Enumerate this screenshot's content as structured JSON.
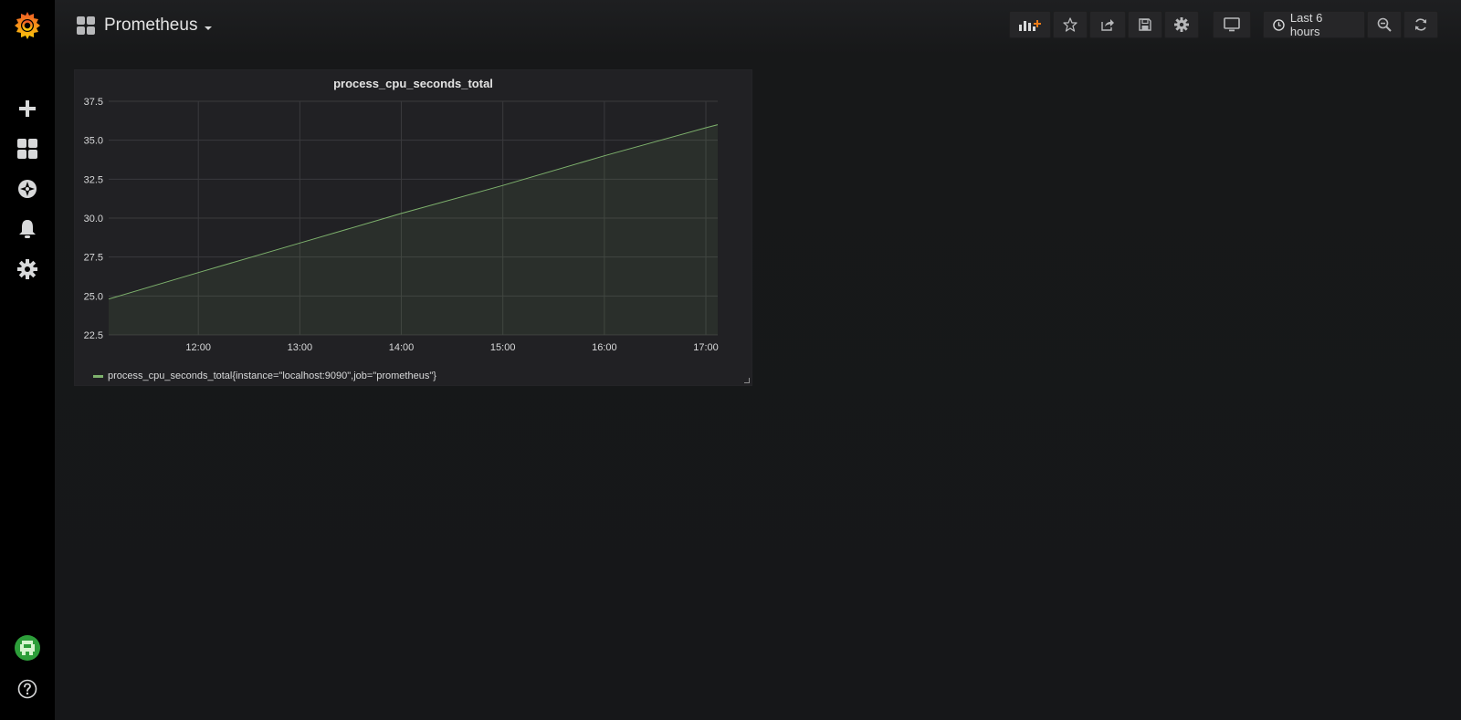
{
  "sidebar": {
    "items": [
      {
        "name": "create",
        "icon": "plus-icon"
      },
      {
        "name": "dashboards",
        "icon": "dashboards-icon"
      },
      {
        "name": "explore",
        "icon": "compass-icon"
      },
      {
        "name": "alerting",
        "icon": "bell-icon"
      },
      {
        "name": "configuration",
        "icon": "gear-icon"
      }
    ],
    "profile_icon": "avatar",
    "help_icon": "help-icon"
  },
  "header": {
    "dashboard_title": "Prometheus",
    "time_range": "Last 6 hours",
    "buttons": [
      "add-panel-icon",
      "star-icon",
      "share-icon",
      "save-icon",
      "settings-icon",
      "tv-icon",
      "zoom-out-icon",
      "refresh-icon"
    ]
  },
  "panel": {
    "title": "process_cpu_seconds_total",
    "legend": "process_cpu_seconds_total{instance=\"localhost:9090\",job=\"prometheus\"}"
  },
  "chart_data": {
    "type": "area",
    "title": "process_cpu_seconds_total",
    "xlabel": "",
    "ylabel": "",
    "x_ticks": [
      "12:00",
      "13:00",
      "14:00",
      "15:00",
      "16:00",
      "17:00"
    ],
    "y_ticks": [
      "22.5",
      "25.0",
      "27.5",
      "30.0",
      "32.5",
      "35.0",
      "37.5"
    ],
    "ylim": [
      22.5,
      37.5
    ],
    "xlim": [
      "11:07",
      "17:07"
    ],
    "grid": true,
    "legend_position": "bottom-left",
    "series": [
      {
        "name": "process_cpu_seconds_total{instance=\"localhost:9090\",job=\"prometheus\"}",
        "color": "#7eb26d",
        "x": [
          "11:07",
          "12:00",
          "13:00",
          "14:00",
          "15:00",
          "16:00",
          "17:00",
          "17:07"
        ],
        "values": [
          24.8,
          26.5,
          28.4,
          30.3,
          32.1,
          34.0,
          35.8,
          36.0
        ]
      }
    ]
  },
  "colors": {
    "background": "#161719",
    "panel": "#212124",
    "series": "#7eb26d",
    "accent": "#eb7b18"
  }
}
